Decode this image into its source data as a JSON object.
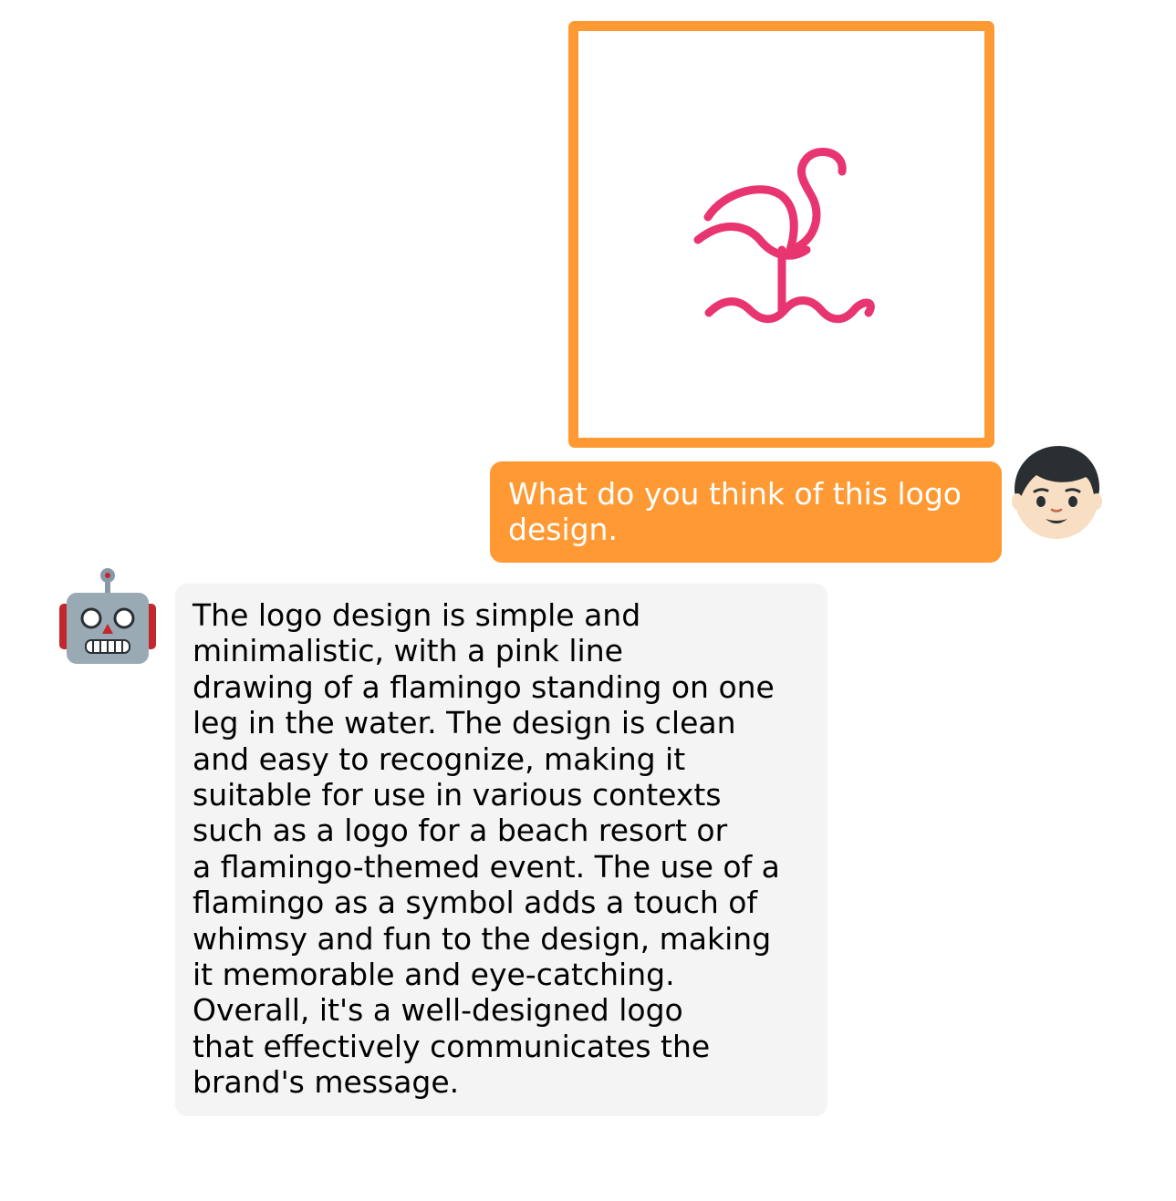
{
  "conversation": {
    "user": {
      "avatar_icon": "boy-face-emoji",
      "image": {
        "icon": "flamingo-line-logo",
        "border_color": "#FF9933",
        "stroke_color": "#E8356F"
      },
      "message": {
        "lines": [
          "What do you think of this logo",
          "design."
        ],
        "bubble_color": "#FF9933",
        "text_color": "#FFFFFF"
      }
    },
    "bot": {
      "avatar_icon": "robot-face-emoji",
      "message": {
        "bubble_color": "#F4F4F4",
        "text_color": "#000000",
        "lines": [
          "The logo design is simple and",
          "minimalistic, with a pink line",
          "drawing of a flamingo standing on one",
          "leg in the water. The design is clean",
          "and easy to recognize, making it",
          "suitable for use in various contexts",
          "such as a logo for a beach resort or",
          "a flamingo-themed event. The use of a",
          "flamingo as a symbol adds a touch of",
          "whimsy and fun to the design, making",
          "it memorable and eye-catching.",
          "Overall, it's a well-designed logo",
          "that effectively communicates the",
          "brand's message."
        ]
      }
    }
  }
}
